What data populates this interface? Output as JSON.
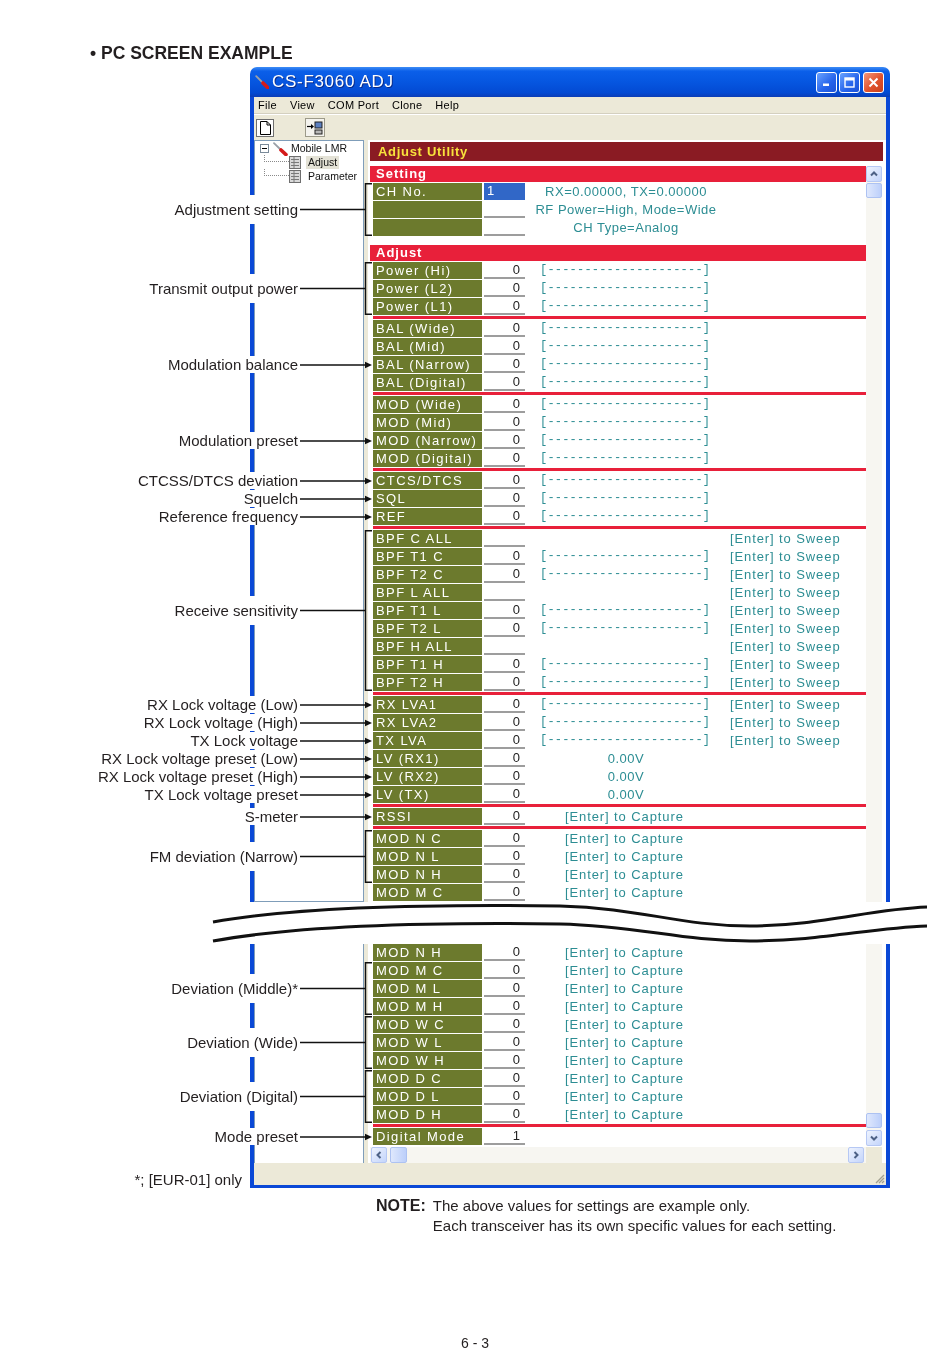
{
  "heading": "• PC SCREEN EXAMPLE",
  "window": {
    "title": "CS-F3060 ADJ",
    "menu": [
      {
        "label": "File"
      },
      {
        "label": "View"
      },
      {
        "label": "COM Port"
      },
      {
        "label": "Clone"
      },
      {
        "label": "Help"
      }
    ],
    "tree": {
      "label": "Mobile LMR",
      "expanded": true,
      "children": [
        {
          "label": "Adjust",
          "selected": true
        },
        {
          "label": "Parameter",
          "selected": false
        }
      ]
    },
    "panel_title": "Adjust Utility",
    "upper_view": {
      "sections": [
        {
          "title": "Setting",
          "groups": [
            {
              "blocks": [
                {
                  "note": "Adjustment setting",
                  "rows": [
                    {
                      "kind": "setting",
                      "label": "CH No.",
                      "value": "1",
                      "selected": true,
                      "info": "RX=0.00000, TX=0.00000"
                    },
                    {
                      "kind": "setting",
                      "selected": false,
                      "info": "RF Power=High, Mode=Wide"
                    },
                    {
                      "kind": "setting",
                      "selected": false,
                      "info": "CH Type=Analog"
                    }
                  ]
                }
              ]
            }
          ]
        },
        {
          "title": "Adjust",
          "groups": [
            {
              "blocks": [
                {
                  "note": "Transmit output power",
                  "rows": [
                    {
                      "kind": "gauge",
                      "label": "Power (Hi)",
                      "value": "0",
                      "gauge": "[---------------------]"
                    },
                    {
                      "kind": "gauge",
                      "label": "Power (L2)",
                      "value": "0",
                      "gauge": "[---------------------]"
                    },
                    {
                      "kind": "gauge",
                      "label": "Power (L1)",
                      "value": "0",
                      "gauge": "[---------------------]"
                    }
                  ]
                }
              ]
            },
            {
              "blocks": [
                {
                  "rows": [
                    {
                      "kind": "gauge",
                      "label": "BAL (Wide)",
                      "value": "0",
                      "gauge": "[---------------------]"
                    },
                    {
                      "kind": "gauge",
                      "label": "BAL (Mid)",
                      "value": "0",
                      "gauge": "[---------------------]"
                    },
                    {
                      "kind": "gauge",
                      "label": "BAL (Narrow)",
                      "value": "0",
                      "gauge": "[---------------------]",
                      "note": "Modulation balance"
                    },
                    {
                      "kind": "gauge",
                      "label": "BAL (Digital)",
                      "value": "0",
                      "gauge": "[---------------------]"
                    }
                  ]
                }
              ]
            },
            {
              "blocks": [
                {
                  "rows": [
                    {
                      "kind": "gauge",
                      "label": "MOD (Wide)",
                      "value": "0",
                      "gauge": "[---------------------]"
                    },
                    {
                      "kind": "gauge",
                      "label": "MOD (Mid)",
                      "value": "0",
                      "gauge": "[---------------------]"
                    },
                    {
                      "kind": "gauge",
                      "label": "MOD (Narrow)",
                      "value": "0",
                      "gauge": "[---------------------]",
                      "note": "Modulation preset"
                    },
                    {
                      "kind": "gauge",
                      "label": "MOD (Digital)",
                      "value": "0",
                      "gauge": "[---------------------]"
                    }
                  ]
                }
              ]
            },
            {
              "blocks": [
                {
                  "rows": [
                    {
                      "kind": "gauge",
                      "label": "CTCS/DTCS",
                      "value": "0",
                      "gauge": "[---------------------]",
                      "note": "CTCSS/DTCS deviation"
                    },
                    {
                      "kind": "gauge",
                      "label": "SQL",
                      "value": "0",
                      "gauge": "[---------------------]",
                      "note": "Squelch"
                    },
                    {
                      "kind": "gauge",
                      "label": "REF",
                      "value": "0",
                      "gauge": "[---------------------]",
                      "note": "Reference frequency"
                    }
                  ]
                }
              ]
            },
            {
              "blocks": [
                {
                  "note": "Receive sensitivity",
                  "rows": [
                    {
                      "kind": "sweep",
                      "label": "BPF C ALL",
                      "action": "[Enter] to Sweep"
                    },
                    {
                      "kind": "sweep",
                      "label": "BPF T1 C",
                      "value": "0",
                      "gauge": "[---------------------]",
                      "action": "[Enter] to Sweep"
                    },
                    {
                      "kind": "sweep",
                      "label": "BPF T2 C",
                      "value": "0",
                      "gauge": "[---------------------]",
                      "action": "[Enter] to Sweep"
                    },
                    {
                      "kind": "sweep",
                      "label": "BPF L ALL",
                      "action": "[Enter] to Sweep"
                    },
                    {
                      "kind": "sweep",
                      "label": "BPF T1 L",
                      "value": "0",
                      "gauge": "[---------------------]",
                      "action": "[Enter] to Sweep"
                    },
                    {
                      "kind": "sweep",
                      "label": "BPF T2 L",
                      "value": "0",
                      "gauge": "[---------------------]",
                      "action": "[Enter] to Sweep"
                    },
                    {
                      "kind": "sweep",
                      "label": "BPF H ALL",
                      "action": "[Enter] to Sweep"
                    },
                    {
                      "kind": "sweep",
                      "label": "BPF T1 H",
                      "value": "0",
                      "gauge": "[---------------------]",
                      "action": "[Enter] to Sweep"
                    },
                    {
                      "kind": "sweep",
                      "label": "BPF T2 H",
                      "value": "0",
                      "gauge": "[---------------------]",
                      "action": "[Enter] to Sweep"
                    }
                  ]
                }
              ]
            },
            {
              "blocks": [
                {
                  "rows": [
                    {
                      "kind": "sweep",
                      "label": "RX LVA1",
                      "value": "0",
                      "gauge": "[---------------------]",
                      "action": "[Enter] to Sweep",
                      "note": "RX Lock voltage (Low)"
                    },
                    {
                      "kind": "sweep",
                      "label": "RX LVA2",
                      "value": "0",
                      "gauge": "[---------------------]",
                      "action": "[Enter] to Sweep",
                      "note": "RX Lock voltage (High)"
                    },
                    {
                      "kind": "sweep",
                      "label": "TX LVA",
                      "value": "0",
                      "gauge": "[---------------------]",
                      "action": "[Enter] to Sweep",
                      "note": "TX Lock voltage"
                    },
                    {
                      "kind": "voltage",
                      "label": "LV (RX1)",
                      "value": "0",
                      "reading": "0.00V",
                      "note": "RX Lock voltage preset (Low)"
                    },
                    {
                      "kind": "voltage",
                      "label": "LV (RX2)",
                      "value": "0",
                      "reading": "0.00V",
                      "note": "RX Lock voltage preset (High)"
                    },
                    {
                      "kind": "voltage",
                      "label": "LV (TX)",
                      "value": "0",
                      "reading": "0.00V",
                      "note": "TX Lock voltage preset"
                    }
                  ]
                }
              ]
            },
            {
              "blocks": [
                {
                  "rows": [
                    {
                      "kind": "capture",
                      "label": "RSSI",
                      "value": "0",
                      "action": "[Enter] to Capture",
                      "note": "S-meter"
                    }
                  ]
                }
              ]
            },
            {
              "blocks": [
                {
                  "note": "FM deviation (Narrow)",
                  "rows": [
                    {
                      "kind": "capture",
                      "label": "MOD N C",
                      "value": "0",
                      "action": "[Enter] to Capture"
                    },
                    {
                      "kind": "capture",
                      "label": "MOD N L",
                      "value": "0",
                      "action": "[Enter] to Capture"
                    },
                    {
                      "kind": "capture",
                      "label": "MOD N H",
                      "value": "0",
                      "action": "[Enter] to Capture"
                    }
                  ]
                },
                {
                  "rows": [
                    {
                      "kind": "capture",
                      "label": "MOD M C",
                      "value": "0",
                      "action": "[Enter] to Capture"
                    }
                  ]
                }
              ]
            }
          ]
        }
      ]
    },
    "lower_view": {
      "groups": [
        {
          "blocks": [
            {
              "rows": [
                {
                  "kind": "capture",
                  "label": "MOD N H",
                  "value": "0",
                  "action": "[Enter] to Capture"
                }
              ]
            },
            {
              "note": "Deviation (Middle)*",
              "rows": [
                {
                  "kind": "capture",
                  "label": "MOD M C",
                  "value": "0",
                  "action": "[Enter] to Capture"
                },
                {
                  "kind": "capture",
                  "label": "MOD M L",
                  "value": "0",
                  "action": "[Enter] to Capture"
                },
                {
                  "kind": "capture",
                  "label": "MOD M H",
                  "value": "0",
                  "action": "[Enter] to Capture"
                }
              ]
            },
            {
              "note": "Deviation (Wide)",
              "rows": [
                {
                  "kind": "capture",
                  "label": "MOD W C",
                  "value": "0",
                  "action": "[Enter] to Capture"
                },
                {
                  "kind": "capture",
                  "label": "MOD W L",
                  "value": "0",
                  "action": "[Enter] to Capture"
                },
                {
                  "kind": "capture",
                  "label": "MOD W H",
                  "value": "0",
                  "action": "[Enter] to Capture"
                }
              ]
            },
            {
              "note": "Deviation (Digital)",
              "rows": [
                {
                  "kind": "capture",
                  "label": "MOD D C",
                  "value": "0",
                  "action": "[Enter] to Capture"
                },
                {
                  "kind": "capture",
                  "label": "MOD D L",
                  "value": "0",
                  "action": "[Enter] to Capture"
                },
                {
                  "kind": "capture",
                  "label": "MOD D H",
                  "value": "0",
                  "action": "[Enter] to Capture"
                }
              ]
            }
          ]
        },
        {
          "blocks": [
            {
              "rows": [
                {
                  "kind": "plain",
                  "label": "Digital Mode",
                  "value": "1",
                  "note": "Mode preset"
                }
              ]
            }
          ]
        }
      ]
    }
  },
  "footnote": "*; [EUR-01] only",
  "note": {
    "label": "NOTE:",
    "lines": [
      "The above values for settings are example only.",
      "Each transceiver has its own specific values for each setting."
    ]
  },
  "page_number": "6 - 3"
}
